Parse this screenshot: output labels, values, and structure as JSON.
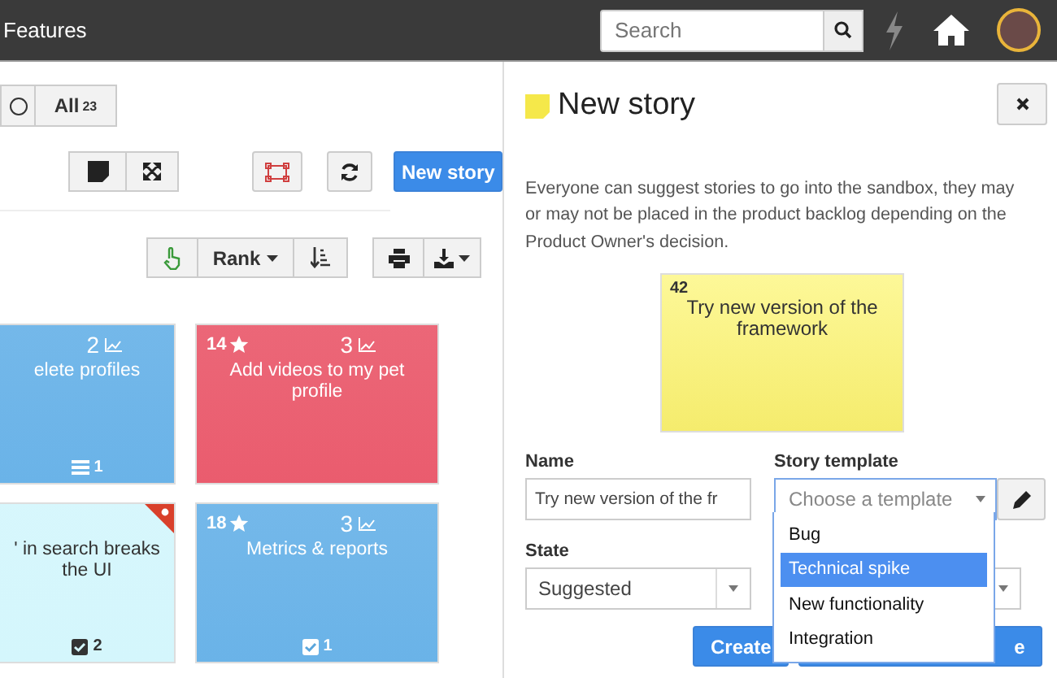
{
  "topbar": {
    "title": "Features",
    "search": {
      "placeholder": "Search"
    }
  },
  "filters": [
    {
      "kind": "circle"
    },
    {
      "kind": "text",
      "label": "All",
      "count": "23"
    }
  ],
  "toolbar": {
    "new_story": "New story",
    "rank": "Rank"
  },
  "card_rows": [
    {
      "cards": [
        {
          "kind": "story",
          "color": "#6ab3e8",
          "points": "2",
          "title": "elete profiles",
          "footer": {
            "kind": "tasks",
            "count": "1"
          }
        },
        {
          "kind": "story",
          "color": "#ea5c6e",
          "rank": "14",
          "points": "3",
          "title": "Add videos to my pet profile"
        }
      ]
    },
    {
      "cards": [
        {
          "kind": "bug",
          "color": "#d4f6fc",
          "title": "' in search breaks the UI",
          "footer": {
            "kind": "checks",
            "count": "2"
          }
        },
        {
          "kind": "story",
          "color": "#6ab3e8",
          "rank": "18",
          "points": "3",
          "title": "Metrics & reports",
          "footer": {
            "kind": "checks",
            "count": "1"
          }
        }
      ]
    }
  ],
  "panel": {
    "title": "New story",
    "description": "Everyone can suggest stories to go into the sandbox, they may or may not be placed in the product backlog depending on the Product Owner's decision.",
    "note": {
      "number": "42",
      "title": "Try new version of the framework"
    },
    "name_label": "Name",
    "name_value": "Try new version of the fr",
    "template_label": "Story template",
    "template_placeholder": "Choose a template",
    "template_options": [
      {
        "label": "Bug",
        "selected": false
      },
      {
        "label": "Technical spike",
        "selected": true
      },
      {
        "label": "New functionality",
        "selected": false
      },
      {
        "label": "Integration",
        "selected": false
      }
    ],
    "state_label": "State",
    "state_value": "Suggested",
    "buttons": [
      "Create",
      "e"
    ]
  }
}
